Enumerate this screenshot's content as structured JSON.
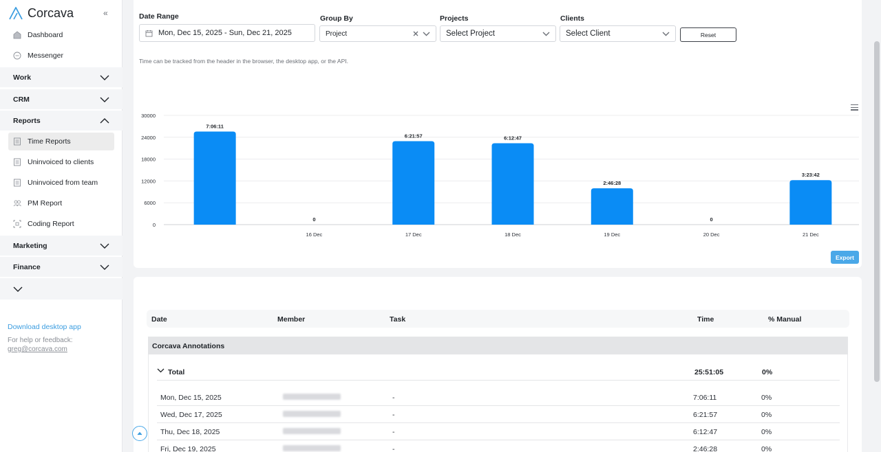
{
  "app": {
    "brand": "Corcava",
    "collapse_glyph": "«"
  },
  "sidebar": {
    "top_items": [
      {
        "label": "Dashboard",
        "icon": "dashboard-icon"
      },
      {
        "label": "Messenger",
        "icon": "chat-icon"
      }
    ],
    "groups": {
      "work": "Work",
      "crm": "CRM",
      "reports": "Reports",
      "marketing": "Marketing",
      "finance": "Finance"
    },
    "report_items": [
      {
        "label": "Time Reports",
        "icon": "document-icon",
        "active": true
      },
      {
        "label": "Uninvoiced to clients",
        "icon": "document-icon"
      },
      {
        "label": "Uninvoiced from team",
        "icon": "document-icon"
      },
      {
        "label": "PM Report",
        "icon": "team-icon"
      },
      {
        "label": "Coding Report",
        "icon": "code-icon"
      }
    ],
    "download": "Download desktop app",
    "help": "For help or feedback:",
    "email": "greg@corcava.com"
  },
  "filters": {
    "date_range_label": "Date Range",
    "date_range_value": "Mon, Dec 15, 2025 - Sun, Dec 21, 2025",
    "group_by_label": "Group By",
    "group_by_value": "Project",
    "projects_label": "Projects",
    "projects_value": "Select Project",
    "clients_label": "Clients",
    "clients_value": "Select Client",
    "reset": "Reset"
  },
  "hint": "Time can be tracked from the header in the browser, the desktop app, or the API.",
  "export": "Export",
  "colors": {
    "bar": "#0a8cf5",
    "accent": "#4aa8e8"
  },
  "chart_data": {
    "type": "bar",
    "categories": [
      "",
      "16 Dec",
      "17 Dec",
      "18 Dec",
      "19 Dec",
      "20 Dec",
      "21 Dec"
    ],
    "values": [
      25571,
      0,
      22917,
      22367,
      9988,
      0,
      12222
    ],
    "data_labels": [
      "7:06:11",
      "0",
      "6:21:57",
      "6:12:47",
      "2:46:28",
      "0",
      "3:23:42"
    ],
    "yticks": [
      "30000",
      "24000",
      "18000",
      "12000",
      "6000",
      "0"
    ],
    "ylim": [
      0,
      30000
    ],
    "grid": true
  },
  "table": {
    "headers": {
      "date": "Date",
      "member": "Member",
      "task": "Task",
      "time": "Time",
      "manual": "% Manual"
    },
    "group_name": "Corcava Annotations",
    "total": {
      "label": "Total",
      "time": "25:51:05",
      "manual": "0%"
    },
    "rows": [
      {
        "date": "Mon, Dec 15, 2025",
        "task": "-",
        "time": "7:06:11",
        "manual": "0%"
      },
      {
        "date": "Wed, Dec 17, 2025",
        "task": "-",
        "time": "6:21:57",
        "manual": "0%"
      },
      {
        "date": "Thu, Dec 18, 2025",
        "task": "-",
        "time": "6:12:47",
        "manual": "0%"
      },
      {
        "date": "Fri, Dec 19, 2025",
        "task": "-",
        "time": "2:46:28",
        "manual": "0%"
      }
    ]
  }
}
